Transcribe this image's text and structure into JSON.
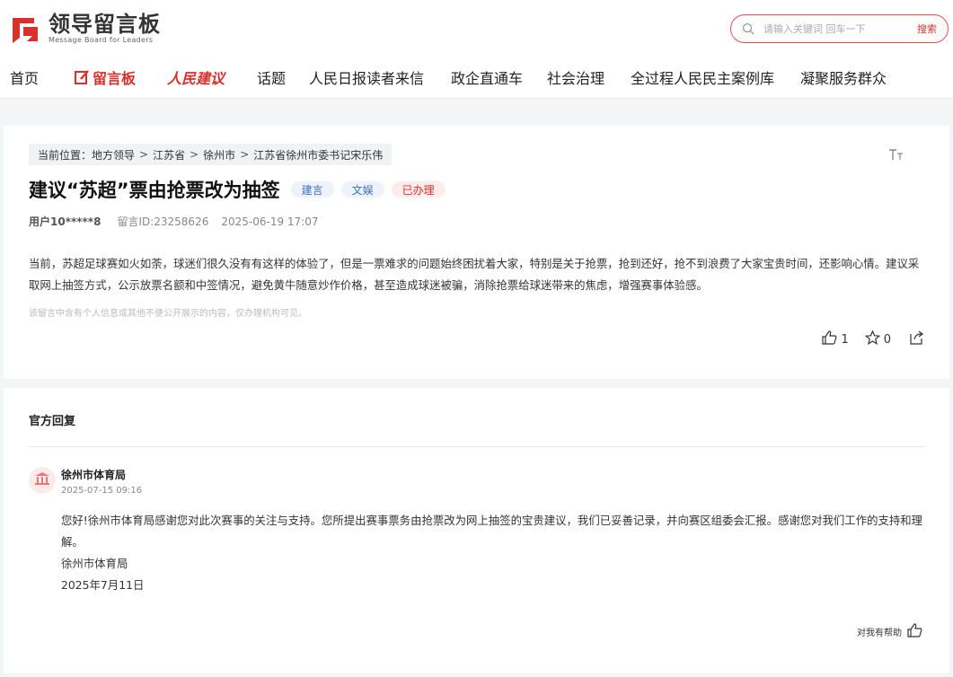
{
  "brand": {
    "name_cn": "领导留言板",
    "name_en": "Message Board for Leaders",
    "color": "#d9302c"
  },
  "search": {
    "placeholder": "请输入关键词 回车一下",
    "button_label": "搜索"
  },
  "nav": {
    "items": [
      {
        "label": "首页"
      },
      {
        "label": "留言板"
      },
      {
        "label": "人民建议"
      },
      {
        "label": "话题"
      },
      {
        "label": "人民日报读者来信"
      },
      {
        "label": "政企直通车"
      },
      {
        "label": "社会治理"
      },
      {
        "label": "全过程人民民主案例库"
      },
      {
        "label": "凝聚服务群众"
      }
    ]
  },
  "breadcrumb": {
    "prefix": "当前位置：",
    "items": [
      "地方领导",
      "江苏省",
      "徐州市",
      "江苏省徐州市委书记宋乐伟"
    ],
    "separator": ">"
  },
  "message": {
    "title": "建议“苏超”票由抢票改为抽签",
    "tags": [
      "建言",
      "文娱"
    ],
    "status": "已办理",
    "user": "用户10*****8",
    "message_id": "留言ID:23258626",
    "date": "2025-06-19 17:07",
    "content": "当前，苏超足球赛如火如荼，球迷们很久没有有这样的体验了，但是一票难求的问题始终困扰着大家，特别是关于抢票，抢到还好，抢不到浪费了大家宝贵时间，还影响心情。建议采取网上抽签方式，公示放票名额和中签情况，避免黄牛随意炒作价格，甚至造成球迷被骗，消除抢票给球迷带来的焦虑，增强赛事体验感。",
    "privacy_note": "该留言中含有个人信息或其他不便公开展示的内容，仅办理机构可见。",
    "likes": "1",
    "favorites": "0"
  },
  "reply": {
    "heading": "官方回复",
    "org": "徐州市体育局",
    "time": "2025-07-15 09:16",
    "body": "您好!徐州市体育局感谢您对此次赛事的关注与支持。您所提出赛事票务由抢票改为网上抽签的宝贵建议，我们已妥善记录，并向赛区组委会汇报。感谢您对我们工作的支持和理解。",
    "signature": "徐州市体育局",
    "sign_date": "2025年7月11日",
    "helpful_label": "对我有帮助"
  }
}
